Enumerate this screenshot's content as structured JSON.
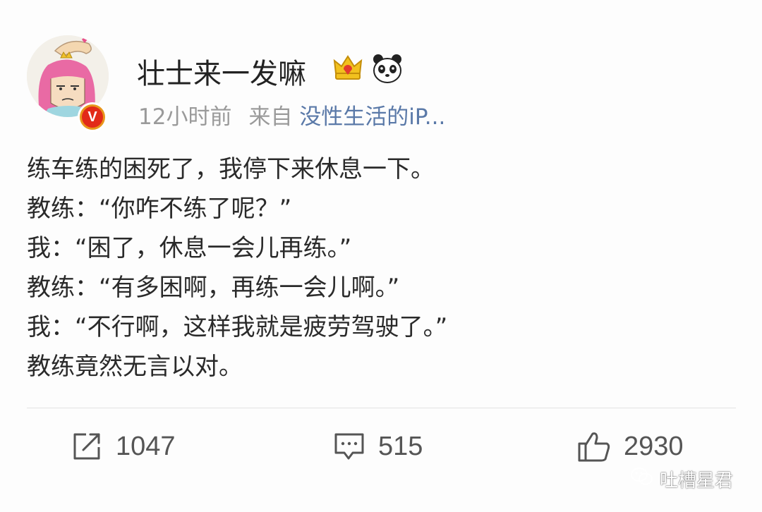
{
  "post": {
    "username": "壮士来一发嘛",
    "time_ago": "12小时前",
    "source_prefix": "来自",
    "source_name": "没性生活的iP...",
    "badges": [
      "crown-icon",
      "panda-icon"
    ],
    "verified_mark": "V",
    "lines": [
      "练车练的困死了，我停下来休息一下。",
      "教练：“你咋不练了呢？”",
      "我：“困了，休息一会儿再练。”",
      "教练：“有多困啊，再练一会儿啊。”",
      "我：“不行啊，这样我就是疲劳驾驶了。”",
      "教练竟然无言以对。"
    ]
  },
  "actions": {
    "repost_count": "1047",
    "comment_count": "515",
    "like_count": "2930"
  },
  "watermark": {
    "label": "吐槽星君",
    "icon": "wechat-icon"
  },
  "colors": {
    "link": "#5a79a8",
    "meta": "#9a9a9a",
    "verified_outer": "#e8961b",
    "verified_inner": "#e22a18"
  }
}
